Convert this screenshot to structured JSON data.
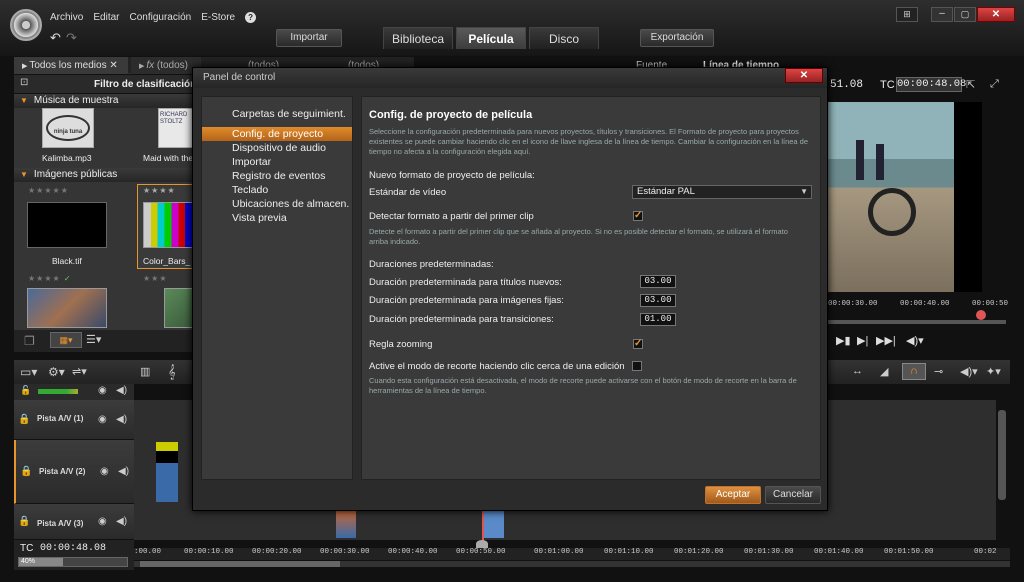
{
  "menu": [
    "Archivo",
    "Editar",
    "Configuración",
    "E-Store",
    "?"
  ],
  "top_buttons": {
    "import": "Importar",
    "export": "Exportación"
  },
  "tabs": [
    "Biblioteca",
    "Película",
    "Disco"
  ],
  "library": {
    "all_media": "Todos los medios",
    "filters": [
      "(todos)",
      "(todos)",
      "(todos)"
    ],
    "sort_filter": "Filtro de clasificación",
    "section_music": "Música de muestra",
    "section_images": "Imágenes públicas",
    "items": [
      "Kalimba.mp3",
      "Maid with the",
      "Black.tif",
      "Color_Bars_"
    ],
    "thumb_text": [
      "ninja tuna",
      "RICHARD STOLTZ"
    ]
  },
  "preview": {
    "source": "Fuente",
    "timeline": "Línea de tiempo",
    "tc_a": "51.08",
    "tc_label": "TC",
    "tc_b": "00:00:48.08",
    "scrub": [
      "00:00:30.00",
      "00:00:40.00",
      "00:00:50"
    ]
  },
  "timeline": {
    "tracks": [
      "Pista A/V (1)",
      "Pista A/V (2)",
      "Pista A/V (3)"
    ],
    "tc_label": "TC",
    "tc": "00:00:48.08",
    "zoom": "40%",
    "ruler": [
      ":00.00",
      "00:00:10.00",
      "00:00:20.00",
      "00:00:30.00",
      "00:00:40.00",
      "00:00:50.00",
      "00:01:00.00",
      "00:01:10.00",
      "00:01:20.00",
      "00:01:30.00",
      "00:01:40.00",
      "00:01:50.00",
      "00:02"
    ]
  },
  "dialog": {
    "title": "Panel de control",
    "sidebar": [
      "Carpetas de seguimient.",
      "Config. de proyecto",
      "Dispositivo de audio",
      "Importar",
      "Registro de eventos",
      "Teclado",
      "Ubicaciones de almacen.",
      "Vista previa"
    ],
    "heading": "Config. de proyecto de película",
    "intro": "Seleccione la configuración predeterminada para nuevos proyectos, títulos y transiciones. El Formato de proyecto para proyectos existentes se puede cambiar haciendo clic en el icono de llave inglesa de la línea de tiempo. Cambiar la configuración en la línea de tiempo no afecta a la configuración elegida aquí.",
    "new_format": "Nuevo formato de proyecto de película:",
    "video_std_label": "Estándar de vídeo",
    "video_std_value": "Estándar PAL",
    "detect_label": "Detectar formato a partir del primer clip",
    "detect_desc": "Detecte el formato a partir del primer clip que se añada al proyecto. Si no es posible detectar el formato, se utilizará el formato arriba indicado.",
    "durations": "Duraciones predeterminadas:",
    "dur_titles": "Duración predeterminada para títulos nuevos:",
    "dur_titles_val": "03.00",
    "dur_images": "Duración predeterminada para imágenes fijas:",
    "dur_images_val": "03.00",
    "dur_trans": "Duración predeterminada para transiciones:",
    "dur_trans_val": "01.00",
    "zoom_label": "Regla zooming",
    "trim_label": "Active el modo de recorte haciendo clic cerca de una edición",
    "trim_desc": "Cuando esta configuración está desactivada, el modo de recorte puede activarse con el botón de modo de recorte en la barra de herramientas de la línea de tiempo.",
    "accept": "Aceptar",
    "cancel": "Cancelar"
  }
}
